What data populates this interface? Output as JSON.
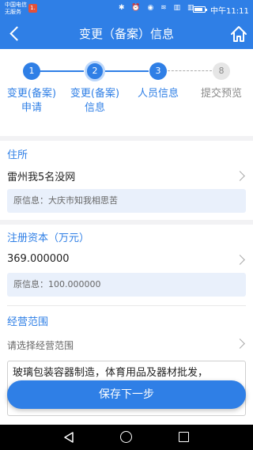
{
  "status_bar": {
    "carrier_line1": "中国电信",
    "carrier_line2": "无服务",
    "carrier_badge": "1.",
    "icons": "✱ ⏰ ◉ ≋ ▥ ▥",
    "clock": "中午11:11",
    "battery_level": 0.85
  },
  "navbar": {
    "title": "变更（备案）信息",
    "back_icon": "chevron-left-icon",
    "home_icon": "home-icon"
  },
  "steps": [
    {
      "number": "1",
      "label_line1": "变更(备案)",
      "label_line2": "申请",
      "state": "done"
    },
    {
      "number": "2",
      "label_line1": "变更(备案)",
      "label_line2": "信息",
      "state": "current"
    },
    {
      "number": "3",
      "label_line1": "人员信息",
      "label_line2": "",
      "state": "done"
    },
    {
      "number": "8",
      "label_line1": "提交预览",
      "label_line2": "",
      "state": "pending"
    }
  ],
  "address": {
    "title": "住所",
    "value": "雷州我5名没网",
    "original": "原信息：大庆市知我相思苦"
  },
  "capital": {
    "title": "注册资本（万元）",
    "value": "369.000000",
    "original": "原信息：100.000000"
  },
  "scope": {
    "title": "经营范围",
    "placeholder": "请选择经营范围",
    "text": "玻璃包装容器制造，体育用品及器材批发，"
  },
  "actions": {
    "save_next": "保存下一步"
  },
  "colors": {
    "primary": "#2f7fe6",
    "pending": "#e6e6e6",
    "info_box": "#e9f0fb"
  }
}
